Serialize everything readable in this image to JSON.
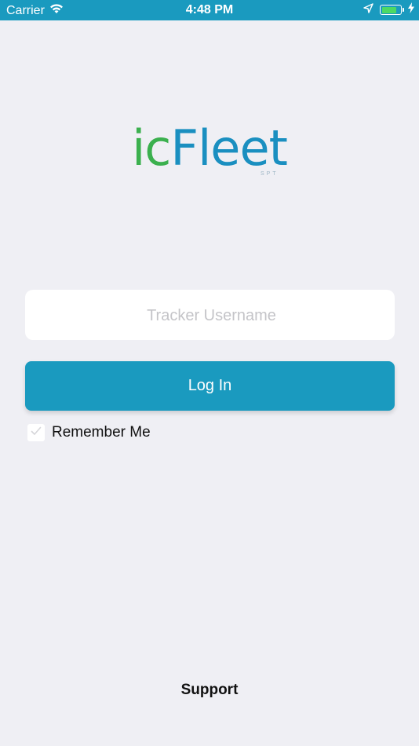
{
  "status_bar": {
    "carrier": "Carrier",
    "time": "4:48 PM",
    "icons": [
      "wifi-icon",
      "location-arrow-icon",
      "battery-icon",
      "charging-bolt-icon"
    ]
  },
  "logo": {
    "part_ic": "ic",
    "part_fleet": "Fleet",
    "subtitle": "SPT"
  },
  "form": {
    "username_placeholder": "Tracker Username",
    "username_value": "",
    "login_label": "Log In",
    "remember_label": "Remember Me",
    "remember_checked": true
  },
  "footer": {
    "support_label": "Support"
  },
  "colors": {
    "accent": "#1a9abf",
    "logo_green": "#3bb04e",
    "logo_blue": "#1a8fc0",
    "background": "#efeff4"
  }
}
